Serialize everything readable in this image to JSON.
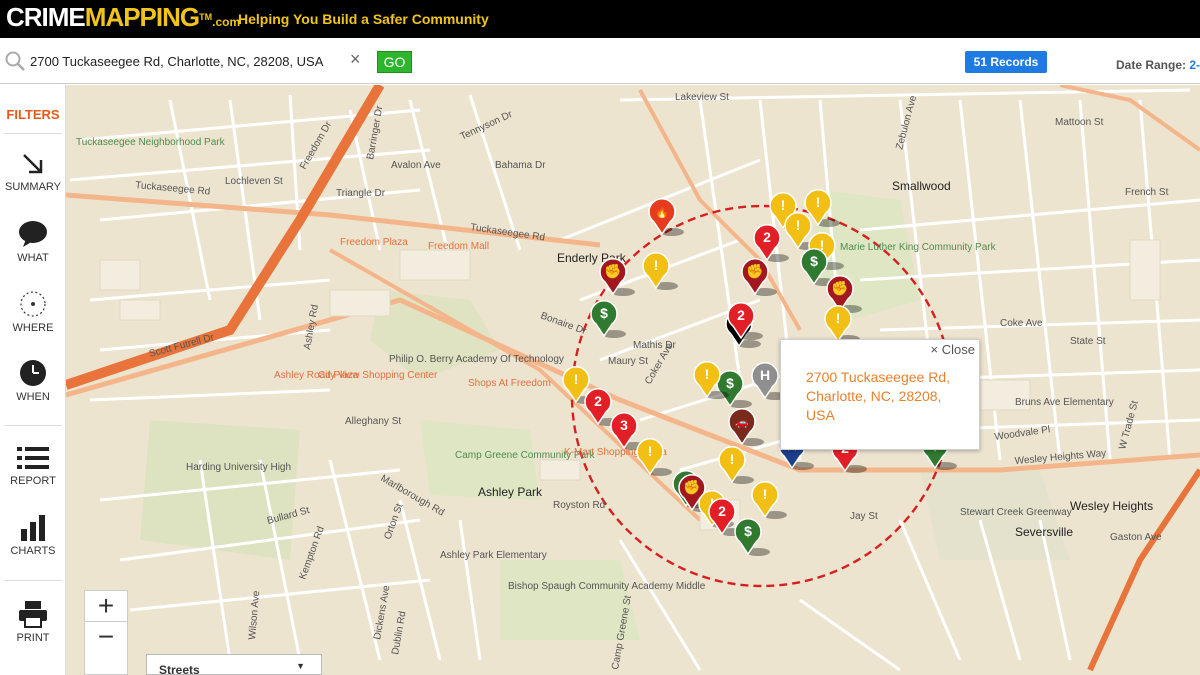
{
  "header": {
    "logo_part1": "CRIME",
    "logo_part2": "MAPPING",
    "logo_tm": "TM",
    "logo_com": ".com",
    "tagline": "Helping You Build a Safer Community"
  },
  "search": {
    "value": "2700 Tuckaseegee Rd, Charlotte, NC, 28208, USA",
    "clear_label": "×",
    "go_label": "GO"
  },
  "records_label": "51 Records",
  "date_range": {
    "label": "Date Range:",
    "value": "2-"
  },
  "sidebar": {
    "filters": "FILTERS",
    "summary": "SUMMARY",
    "what": "WHAT",
    "where": "WHERE",
    "when": "WHEN",
    "report": "REPORT",
    "charts": "CHARTS",
    "print": "PRINT"
  },
  "popup": {
    "close_label": "× Close",
    "address": "2700 Tuckaseegee Rd, Charlotte, NC, 28208, USA"
  },
  "zoom": {
    "in": "+",
    "out": "−"
  },
  "layer_select": {
    "value": "Streets"
  },
  "map_labels": [
    "Enderly Park",
    "Ashley Park",
    "Smallwood",
    "Seversville",
    "Wesley Heights",
    "Tuckaseegee Rd",
    "Freedom Dr",
    "Scott Futrell Dr",
    "Alleghany St",
    "Royston Rd",
    "Bahama Dr",
    "Avalon Ave",
    "Triangle Dr",
    "Lochleven St",
    "Tennyson Dr",
    "Mathis Dr",
    "Maury St",
    "Coker Ave",
    "Bonaire Dr",
    "Ashley Rd",
    "Camp Greene Community Park",
    "Freedom Plaza",
    "Freedom Mall",
    "City View Shopping Center",
    "Philip O. Berry Academy Of Technology",
    "Shops At Freedom",
    "Harding University High",
    "Ashley Park Elementary",
    "Bishop Spaugh Community Academy Middle",
    "Marlborough Rd",
    "Bullard St",
    "Kempton Rd",
    "Wilson Ave",
    "Dickens Ave",
    "Coke Ave",
    "State St",
    "Woodvale Pl",
    "Wesley Heights Way",
    "W Trade St",
    "Lakeview St",
    "Zebulon Ave",
    "French St",
    "Mattoon St",
    "Bruns Ave Elementary",
    "Stewart Creek Greenway",
    "Jay St",
    "Barringer Dr",
    "Gaston Ave",
    "K-Mart Shopping Plaza",
    "Ashley Road Plaza",
    "Tuckaseegee Neighborhood Park",
    "Marie Luther King Community Park",
    "Dublin Rd",
    "Orton St",
    "Camp Greene St"
  ],
  "markers": [
    {
      "type": "arson",
      "color": "#e53b1f",
      "glyph": "🔥"
    },
    {
      "type": "caution",
      "color": "#f2c014",
      "glyph": "!"
    },
    {
      "type": "assault",
      "color": "#a3181f",
      "glyph": "✊"
    },
    {
      "type": "theft",
      "color": "#2f7a2f",
      "glyph": "$"
    },
    {
      "type": "multiple",
      "color": "#e21f26",
      "glyph": "2"
    },
    {
      "type": "multiple",
      "color": "#e21f26",
      "glyph": "3"
    },
    {
      "type": "burglary",
      "color": "#000000",
      "glyph": "◗"
    },
    {
      "type": "vehicle",
      "color": "#7a2a1d",
      "glyph": "🚗"
    },
    {
      "type": "police",
      "color": "#1d3f8a",
      "glyph": "★"
    },
    {
      "type": "hospital",
      "color": "#8f8f8f",
      "glyph": "H"
    }
  ]
}
